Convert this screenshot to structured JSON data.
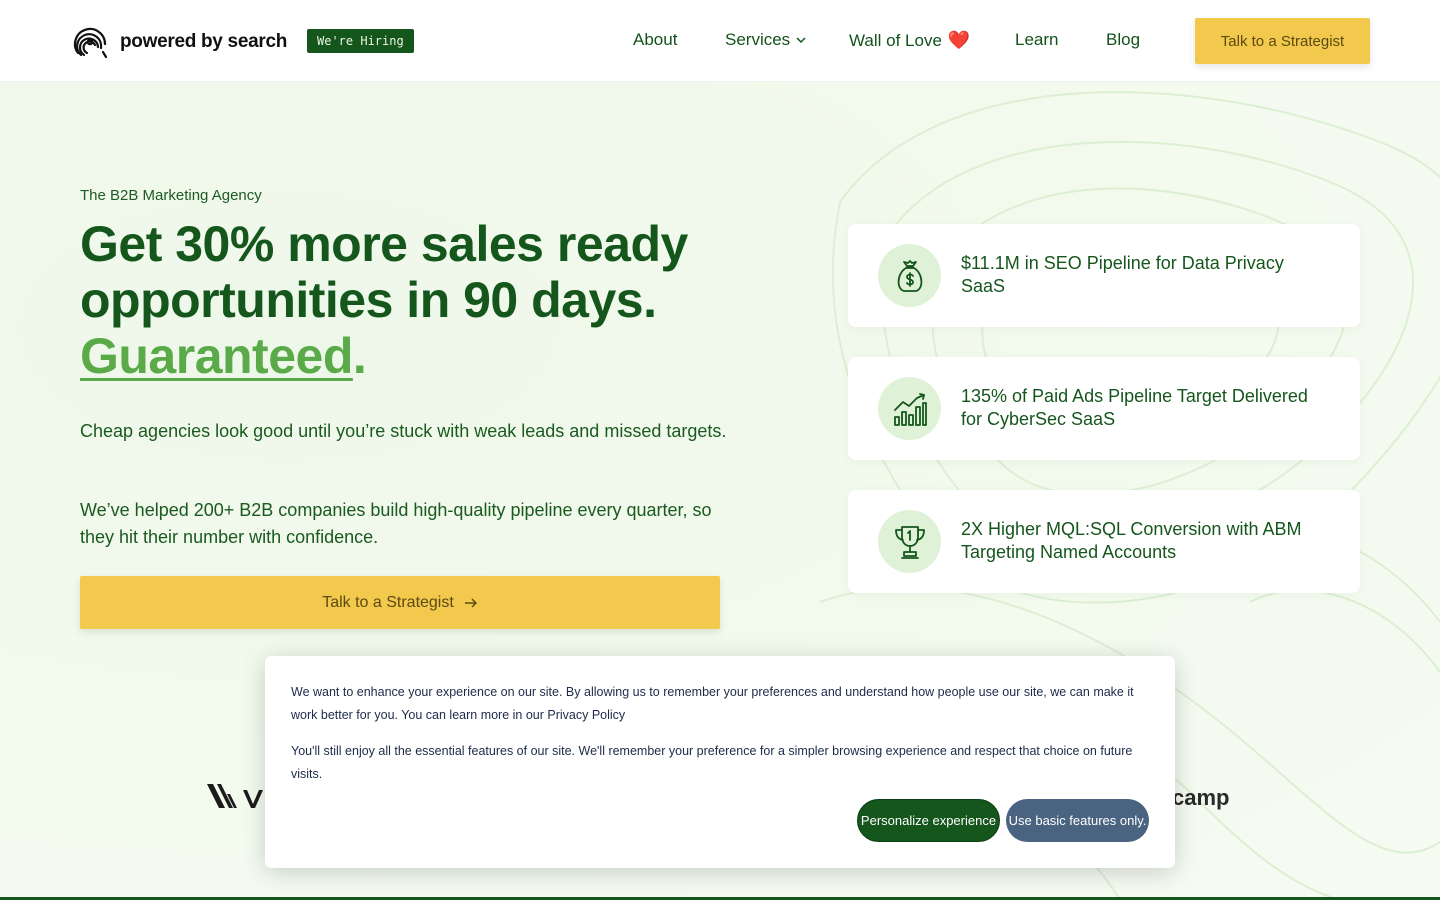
{
  "header": {
    "logo_text": "powered by search",
    "hiring_badge": "We're Hiring",
    "nav": [
      {
        "label": "About"
      },
      {
        "label": "Services"
      },
      {
        "label": "Wall of Love"
      },
      {
        "label": "Learn"
      },
      {
        "label": "Blog"
      }
    ],
    "heart_glyph": "❤️",
    "cta": "Talk to a Strategist"
  },
  "hero": {
    "eyebrow": "The B2B Marketing Agency",
    "headline_line1": "Get 30% more sales ready",
    "headline_line2": "opportunities in 90 days.",
    "headline_accent": "Guaranteed",
    "headline_accent_dot": ".",
    "para1": "Cheap agencies look good until you’re stuck with weak leads and missed targets.",
    "para2": "We’ve helped 200+ B2B companies build high-quality pipeline every quarter, so they hit their number with confidence.",
    "cta": "Talk to a Strategist"
  },
  "stats": [
    {
      "icon": "money-bag-icon",
      "text": "$11.1M in SEO Pipeline for Data Privacy SaaS"
    },
    {
      "icon": "growth-chart-icon",
      "text": "135% of Paid Ads Pipeline Target Delivered for CyberSec SaaS"
    },
    {
      "icon": "trophy-icon",
      "text": "2X Higher MQL:SQL Conversion with ABM Targeting Named Accounts"
    }
  ],
  "logos": {
    "right_partial": "camp"
  },
  "cookie": {
    "para1": "We want to enhance your experience on our site. By allowing us to remember your preferences and understand how people use our site, we can make it work better for you. You can learn more in our Privacy Policy",
    "para2": "You'll still enjoy all the essential features of our site. We'll remember your preference for a simpler browsing experience and respect that choice on future visits.",
    "personalize_btn": "Personalize experience",
    "basic_btn": "Use basic features only."
  },
  "colors": {
    "brand_green": "#15561c",
    "accent_green": "#5aaa4a",
    "cta_yellow": "#f2c94c",
    "basic_btn": "#4a6380"
  }
}
